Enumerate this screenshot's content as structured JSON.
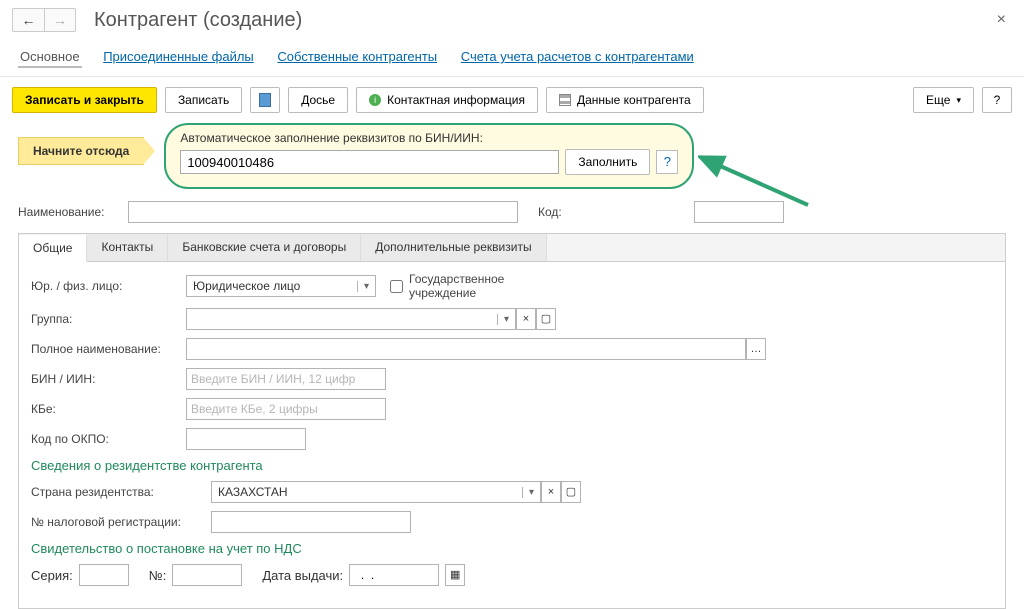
{
  "title": "Контрагент (создание)",
  "nav": {
    "back": "←",
    "fwd": "→"
  },
  "linktabs": {
    "main": "Основное",
    "files": "Присоединенные файлы",
    "own": "Собственные контрагенты",
    "accounts": "Счета учета расчетов с контрагентами"
  },
  "toolbar": {
    "save_close": "Записать и закрыть",
    "save": "Записать",
    "dossier": "Досье",
    "contact": "Контактная информация",
    "data": "Данные контрагента",
    "more": "Еще",
    "help": "?"
  },
  "start_label": "Начните отсюда",
  "autofill": {
    "label": "Автоматическое заполнение реквизитов по БИН/ИИН:",
    "value": "100940010486",
    "btn": "Заполнить",
    "q": "?"
  },
  "name_label": "Наименование:",
  "code_label": "Код:",
  "tabs": {
    "t1": "Общие",
    "t2": "Контакты",
    "t3": "Банковские счета и договоры",
    "t4": "Дополнительные реквизиты"
  },
  "fields": {
    "legaltype_label": "Юр. / физ. лицо:",
    "legaltype_value": "Юридическое лицо",
    "gov_label": "Государственное учреждение",
    "group_label": "Группа:",
    "fullname_label": "Полное наименование:",
    "bin_label": "БИН / ИИН:",
    "bin_placeholder": "Введите БИН / ИИН, 12 цифр",
    "kbe_label": "КБе:",
    "kbe_placeholder": "Введите КБе, 2 цифры",
    "okpo_label": "Код по ОКПО:",
    "section1": "Сведения о резидентстве контрагента",
    "country_label": "Страна резидентства:",
    "country_value": "КАЗАХСТАН",
    "taxreg_label": "№ налоговой регистрации:",
    "section2": "Свидетельство о постановке на учет по НДС",
    "series_label": "Серия:",
    "num_label": "№:",
    "date_label": "Дата выдачи:",
    "date_value": "  .  .    "
  }
}
